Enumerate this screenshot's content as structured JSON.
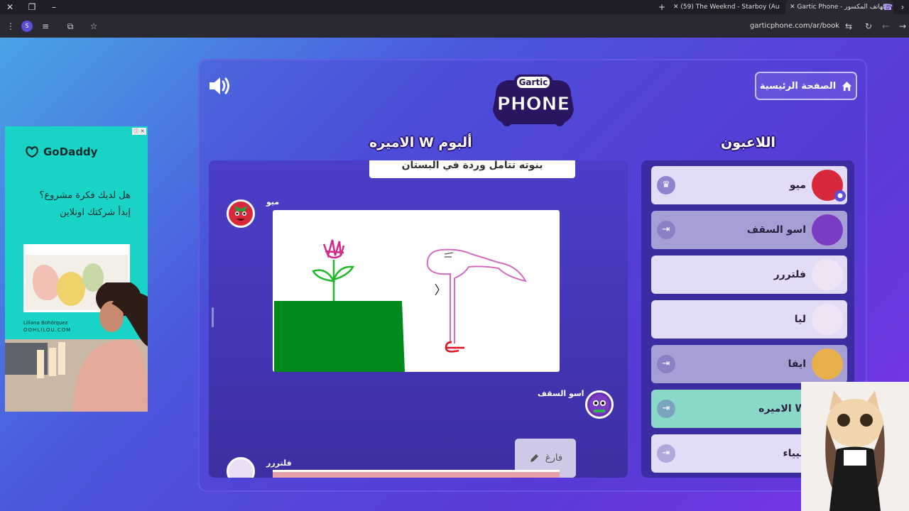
{
  "browser": {
    "tabs": [
      {
        "title": "(59) The Weeknd - Starboy (Au"
      },
      {
        "title": "Gartic Phone - الهاتف المكسور"
      }
    ],
    "url": "garticphone.com/ar/book"
  },
  "ad": {
    "brand": "GoDaddy",
    "headline_1": "هل لديك فكرة مشروع؟",
    "headline_2": "إبدأ شركتك اونلاين",
    "author_name": "Liliana Bohórquez",
    "author_site": "OOHLILOU.COM"
  },
  "header": {
    "logo_line1": "Gartic",
    "logo_line2": "PHONE",
    "home_label": "الصفحة الرئيسية"
  },
  "album": {
    "title": "ألبوم W الاميره",
    "caption": "بنوته تتأمل وردة في البستان",
    "entries": [
      {
        "author": "ميو"
      },
      {
        "author": "اسو السقف",
        "bubble_text": "فارغ"
      },
      {
        "author": "فلتررر"
      }
    ]
  },
  "players": {
    "title": "اللاعبون",
    "list": [
      {
        "name": "ميو"
      },
      {
        "name": "اسو السقف"
      },
      {
        "name": "فلتررر"
      },
      {
        "name": "ليا"
      },
      {
        "name": "ايفا"
      },
      {
        "name": "W الاميره"
      },
      {
        "name": "ميياء"
      }
    ]
  },
  "colors": {
    "accent_green": "#8ad8c8",
    "panel_bg": "#3b2da1",
    "drawing_green": "#008a1e",
    "drawing_pink": "#d36cc0",
    "drawing_red": "#e0141e"
  }
}
